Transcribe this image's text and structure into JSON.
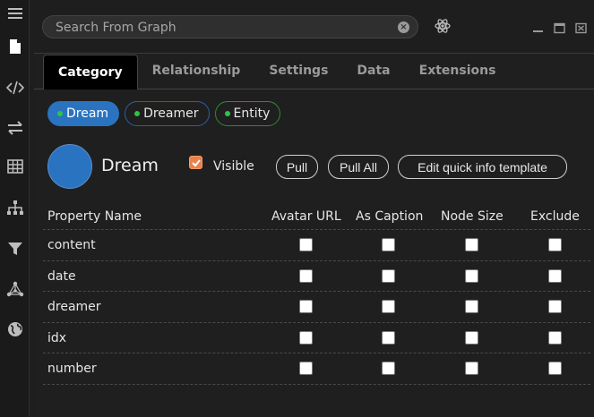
{
  "search": {
    "placeholder": "Search From Graph"
  },
  "tabs": [
    {
      "label": "Category",
      "active": true
    },
    {
      "label": "Relationship",
      "active": false
    },
    {
      "label": "Settings",
      "active": false
    },
    {
      "label": "Data",
      "active": false
    },
    {
      "label": "Extensions",
      "active": false
    }
  ],
  "categories": [
    {
      "label": "Dream",
      "selected": true
    },
    {
      "label": "Dreamer",
      "selected": false
    },
    {
      "label": "Entity",
      "selected": false
    }
  ],
  "category": {
    "name": "Dream",
    "color": "#2a73c0",
    "visible_label": "Visible",
    "visible_checked": true
  },
  "actions": {
    "pull": "Pull",
    "pull_all": "Pull All",
    "edit_template": "Edit quick info template"
  },
  "table": {
    "headers": {
      "property_name": "Property Name",
      "avatar_url": "Avatar URL",
      "as_caption": "As Caption",
      "node_size": "Node Size",
      "exclude": "Exclude"
    },
    "rows": [
      {
        "name": "content"
      },
      {
        "name": "date"
      },
      {
        "name": "dreamer"
      },
      {
        "name": "idx"
      },
      {
        "name": "number"
      }
    ]
  },
  "icons": {
    "rail": [
      "menu-icon",
      "document-icon",
      "code-icon",
      "swap-icon",
      "table-icon",
      "hierarchy-icon",
      "filter-icon",
      "graph-icon",
      "globe-icon"
    ]
  }
}
